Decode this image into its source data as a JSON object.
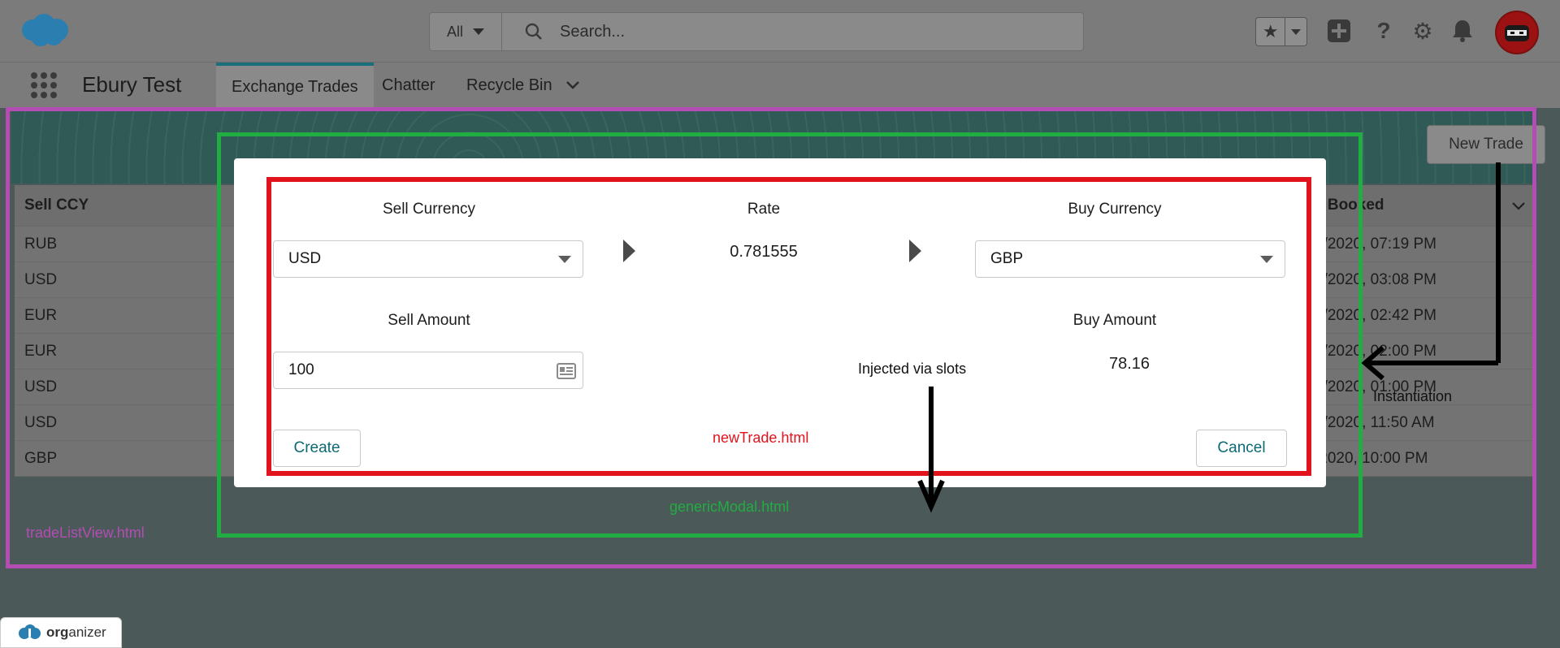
{
  "header": {
    "search_scope": "All",
    "search_placeholder": "Search..."
  },
  "nav": {
    "app_name": "Ebury Test",
    "tabs": [
      {
        "label": "Exchange Trades"
      },
      {
        "label": "Chatter"
      },
      {
        "label": "Recycle Bin"
      }
    ]
  },
  "list": {
    "new_button": "New Trade",
    "columns": [
      "Sell CCY",
      "e Booked"
    ],
    "rows": [
      {
        "sell_ccy": "RUB",
        "booked": "2/2020, 07:19 PM"
      },
      {
        "sell_ccy": "USD",
        "booked": "2/2020, 03:08 PM"
      },
      {
        "sell_ccy": "EUR",
        "booked": "2/2020, 02:42 PM"
      },
      {
        "sell_ccy": "EUR",
        "booked": "2/2020, 02:00 PM"
      },
      {
        "sell_ccy": "USD",
        "booked": "2/2020, 01:00 PM"
      },
      {
        "sell_ccy": "USD",
        "booked": "2/2020, 11:50 AM"
      },
      {
        "sell_ccy": "GBP",
        "booked": "/2020, 10:00 PM"
      }
    ]
  },
  "modal": {
    "sell_currency_label": "Sell Currency",
    "sell_currency_value": "USD",
    "rate_label": "Rate",
    "rate_value": "0.781555",
    "buy_currency_label": "Buy Currency",
    "buy_currency_value": "GBP",
    "sell_amount_label": "Sell Amount",
    "sell_amount_value": "100",
    "buy_amount_label": "Buy Amount",
    "buy_amount_value": "78.16",
    "create_label": "Create",
    "cancel_label": "Cancel"
  },
  "annotations": {
    "new_trade_file": "newTrade.html",
    "generic_modal_file": "genericModal.html",
    "trade_list_file": "tradeListView.html",
    "injected_note": "Injected via slots",
    "instantiation_note": "Instantiation",
    "colors": {
      "purple": "#b34cb3",
      "green": "#20ad42",
      "red": "#e1141d"
    }
  },
  "footer": {
    "badge_text_bold": "org",
    "badge_text": "anizer"
  }
}
